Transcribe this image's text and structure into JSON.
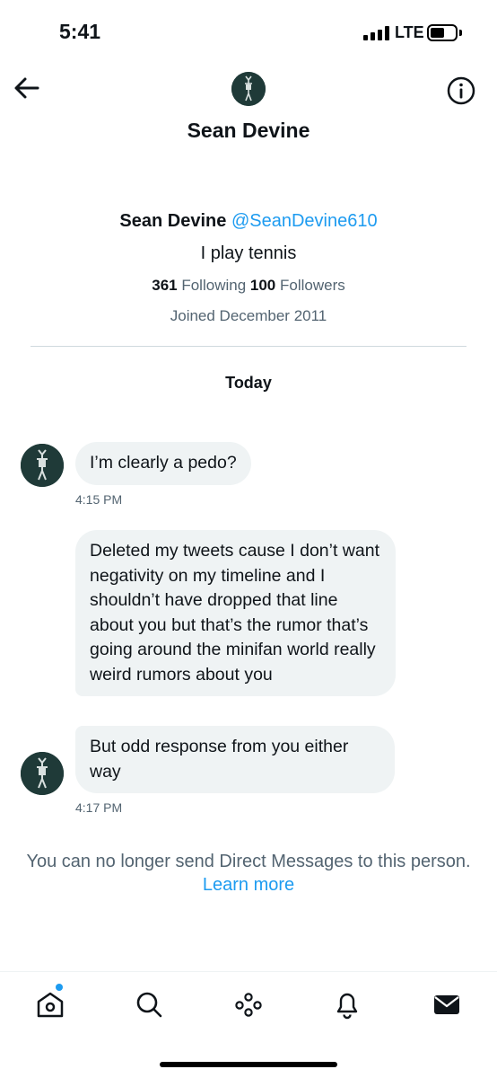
{
  "status_bar": {
    "time": "5:41",
    "network": "LTE"
  },
  "header": {
    "title": "Sean Devine",
    "back_icon": "arrow-left-icon",
    "info_icon": "info-circle-icon"
  },
  "profile": {
    "name": "Sean Devine",
    "handle": "@SeanDevine610",
    "bio": "I play tennis",
    "following_count": "361",
    "following_label": "Following",
    "followers_count": "100",
    "followers_label": "Followers",
    "joined": "Joined December 2011"
  },
  "conversation": {
    "date_label": "Today",
    "messages": [
      {
        "text": "I’m clearly a pedo?"
      },
      {
        "text": "Deleted my tweets cause I don’t want negativity on my timeline and I shouldn’t have dropped that line about you but that’s the rumor that’s going around the minifan world  really weird rumors about you"
      },
      {
        "text": "But odd response from you either way"
      }
    ],
    "timestamps": [
      "4:15 PM",
      "4:17 PM"
    ]
  },
  "notice": {
    "text": "You can no longer send Direct Messages to this person.",
    "link": "Learn more"
  },
  "tab_bar": {
    "items": [
      "home-icon",
      "search-icon",
      "spaces-icon",
      "notifications-icon",
      "messages-icon"
    ]
  },
  "colors": {
    "accent": "#1d9bf0",
    "bubble": "#eff3f4",
    "muted": "#536471"
  }
}
